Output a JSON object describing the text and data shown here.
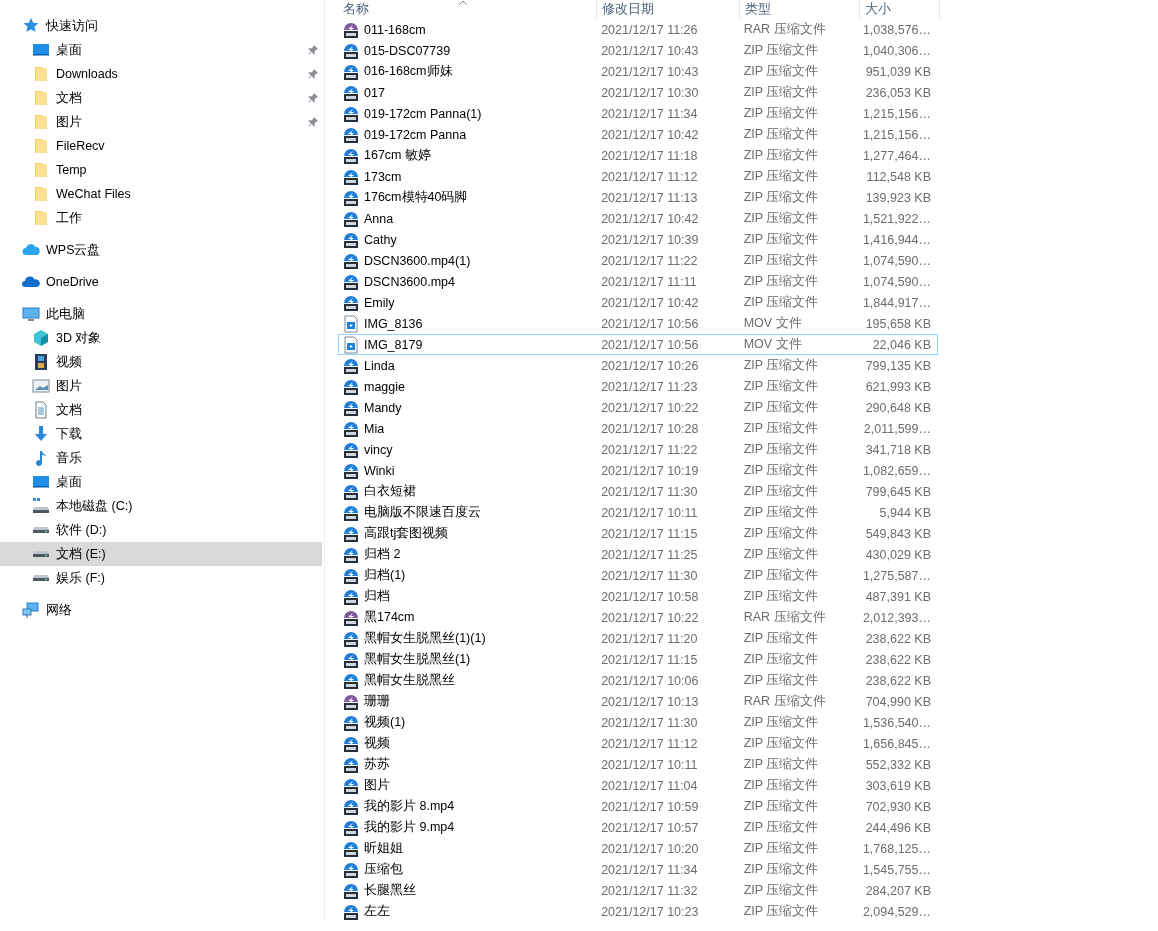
{
  "sidebar": {
    "items": [
      {
        "label": "快速访问",
        "kind": "star",
        "selected": false,
        "children": [
          {
            "label": "桌面",
            "kind": "desktop",
            "pinned": true,
            "selected": false
          },
          {
            "label": "Downloads",
            "kind": "folder",
            "pinned": true,
            "selected": false
          },
          {
            "label": "文档",
            "kind": "folder",
            "pinned": true,
            "selected": false
          },
          {
            "label": "图片",
            "kind": "folder",
            "pinned": true,
            "selected": false
          },
          {
            "label": "FileRecv",
            "kind": "folder",
            "pinned": false,
            "selected": false
          },
          {
            "label": "Temp",
            "kind": "folder",
            "pinned": false,
            "selected": false
          },
          {
            "label": "WeChat Files",
            "kind": "folder",
            "pinned": false,
            "selected": false
          },
          {
            "label": "工作",
            "kind": "folder",
            "pinned": false,
            "selected": false
          }
        ]
      },
      {
        "label": "WPS云盘",
        "kind": "cloud",
        "selected": false
      },
      {
        "label": "OneDrive",
        "kind": "onedrive",
        "selected": false
      },
      {
        "label": "此电脑",
        "kind": "pc",
        "selected": false,
        "children": [
          {
            "label": "3D 对象",
            "kind": "cube",
            "selected": false
          },
          {
            "label": "视频",
            "kind": "film",
            "selected": false
          },
          {
            "label": "图片",
            "kind": "image",
            "selected": false
          },
          {
            "label": "文档",
            "kind": "document",
            "selected": false
          },
          {
            "label": "下载",
            "kind": "download",
            "selected": false
          },
          {
            "label": "音乐",
            "kind": "music",
            "selected": false
          },
          {
            "label": "桌面",
            "kind": "desktop",
            "selected": false
          },
          {
            "label": "本地磁盘 (C:)",
            "kind": "sysdrive",
            "selected": false
          },
          {
            "label": "软件 (D:)",
            "kind": "drive",
            "selected": false
          },
          {
            "label": "文档 (E:)",
            "kind": "drive",
            "selected": true
          },
          {
            "label": "娱乐 (F:)",
            "kind": "drive",
            "selected": false
          }
        ]
      },
      {
        "label": "网络",
        "kind": "network",
        "selected": false
      }
    ]
  },
  "file_list": {
    "columns": [
      {
        "label": "名称",
        "sorted": true
      },
      {
        "label": "修改日期",
        "sorted": false
      },
      {
        "label": "类型",
        "sorted": false
      },
      {
        "label": "大小",
        "sorted": false
      }
    ],
    "rows": [
      {
        "name": "011-168cm",
        "kind": "rar",
        "modified": "2021/12/17 11:26",
        "type": "RAR 压缩文件",
        "size": "1,038,576…",
        "focused": false
      },
      {
        "name": "015-DSC07739",
        "kind": "zip",
        "modified": "2021/12/17 10:43",
        "type": "ZIP 压缩文件",
        "size": "1,040,306…",
        "focused": false
      },
      {
        "name": "016-168cm师妹",
        "kind": "zip",
        "modified": "2021/12/17 10:43",
        "type": "ZIP 压缩文件",
        "size": "951,039 KB",
        "focused": false
      },
      {
        "name": "017",
        "kind": "zip",
        "modified": "2021/12/17 10:30",
        "type": "ZIP 压缩文件",
        "size": "236,053 KB",
        "focused": false
      },
      {
        "name": "019-172cm Panna(1)",
        "kind": "zip",
        "modified": "2021/12/17 11:34",
        "type": "ZIP 压缩文件",
        "size": "1,215,156…",
        "focused": false
      },
      {
        "name": "019-172cm Panna",
        "kind": "zip",
        "modified": "2021/12/17 10:42",
        "type": "ZIP 压缩文件",
        "size": "1,215,156…",
        "focused": false
      },
      {
        "name": "167cm 敏婷",
        "kind": "zip",
        "modified": "2021/12/17 11:18",
        "type": "ZIP 压缩文件",
        "size": "1,277,464…",
        "focused": false
      },
      {
        "name": "173cm",
        "kind": "zip",
        "modified": "2021/12/17 11:12",
        "type": "ZIP 压缩文件",
        "size": "112,548 KB",
        "focused": false
      },
      {
        "name": "176cm模特40码脚",
        "kind": "zip",
        "modified": "2021/12/17 11:13",
        "type": "ZIP 压缩文件",
        "size": "139,923 KB",
        "focused": false
      },
      {
        "name": "Anna",
        "kind": "zip",
        "modified": "2021/12/17 10:42",
        "type": "ZIP 压缩文件",
        "size": "1,521,922…",
        "focused": false
      },
      {
        "name": "Cathy",
        "kind": "zip",
        "modified": "2021/12/17 10:39",
        "type": "ZIP 压缩文件",
        "size": "1,416,944…",
        "focused": false
      },
      {
        "name": "DSCN3600.mp4(1)",
        "kind": "zip",
        "modified": "2021/12/17 11:22",
        "type": "ZIP 压缩文件",
        "size": "1,074,590…",
        "focused": false
      },
      {
        "name": "DSCN3600.mp4",
        "kind": "zip",
        "modified": "2021/12/17 11:11",
        "type": "ZIP 压缩文件",
        "size": "1,074,590…",
        "focused": false
      },
      {
        "name": "Emily",
        "kind": "zip",
        "modified": "2021/12/17 10:42",
        "type": "ZIP 压缩文件",
        "size": "1,844,917…",
        "focused": false
      },
      {
        "name": "IMG_8136",
        "kind": "mov",
        "modified": "2021/12/17 10:56",
        "type": "MOV 文件",
        "size": "195,658 KB",
        "focused": false
      },
      {
        "name": "IMG_8179",
        "kind": "mov",
        "modified": "2021/12/17 10:56",
        "type": "MOV 文件",
        "size": "22,046 KB",
        "focused": true
      },
      {
        "name": "Linda",
        "kind": "zip",
        "modified": "2021/12/17 10:26",
        "type": "ZIP 压缩文件",
        "size": "799,135 KB",
        "focused": false
      },
      {
        "name": "maggie",
        "kind": "zip",
        "modified": "2021/12/17 11:23",
        "type": "ZIP 压缩文件",
        "size": "621,993 KB",
        "focused": false
      },
      {
        "name": "Mandy",
        "kind": "zip",
        "modified": "2021/12/17 10:22",
        "type": "ZIP 压缩文件",
        "size": "290,648 KB",
        "focused": false
      },
      {
        "name": "Mia",
        "kind": "zip",
        "modified": "2021/12/17 10:28",
        "type": "ZIP 压缩文件",
        "size": "2,011,599…",
        "focused": false
      },
      {
        "name": "vincy",
        "kind": "zip",
        "modified": "2021/12/17 11:22",
        "type": "ZIP 压缩文件",
        "size": "341,718 KB",
        "focused": false
      },
      {
        "name": "Winki",
        "kind": "zip",
        "modified": "2021/12/17 10:19",
        "type": "ZIP 压缩文件",
        "size": "1,082,659…",
        "focused": false
      },
      {
        "name": "白衣短裙",
        "kind": "zip",
        "modified": "2021/12/17 11:30",
        "type": "ZIP 压缩文件",
        "size": "799,645 KB",
        "focused": false
      },
      {
        "name": "电脑版不限速百度云",
        "kind": "zip",
        "modified": "2021/12/17 10:11",
        "type": "ZIP 压缩文件",
        "size": "5,944 KB",
        "focused": false
      },
      {
        "name": "高跟tj套图视频",
        "kind": "zip",
        "modified": "2021/12/17 11:15",
        "type": "ZIP 压缩文件",
        "size": "549,843 KB",
        "focused": false
      },
      {
        "name": "归档 2",
        "kind": "zip",
        "modified": "2021/12/17 11:25",
        "type": "ZIP 压缩文件",
        "size": "430,029 KB",
        "focused": false
      },
      {
        "name": "归档(1)",
        "kind": "zip",
        "modified": "2021/12/17 11:30",
        "type": "ZIP 压缩文件",
        "size": "1,275,587…",
        "focused": false
      },
      {
        "name": "归档",
        "kind": "zip",
        "modified": "2021/12/17 10:58",
        "type": "ZIP 压缩文件",
        "size": "487,391 KB",
        "focused": false
      },
      {
        "name": "黑174cm",
        "kind": "rar",
        "modified": "2021/12/17 10:22",
        "type": "RAR 压缩文件",
        "size": "2,012,393…",
        "focused": false
      },
      {
        "name": "黑帽女生脱黑丝(1)(1)",
        "kind": "zip",
        "modified": "2021/12/17 11:20",
        "type": "ZIP 压缩文件",
        "size": "238,622 KB",
        "focused": false
      },
      {
        "name": "黑帽女生脱黑丝(1)",
        "kind": "zip",
        "modified": "2021/12/17 11:15",
        "type": "ZIP 压缩文件",
        "size": "238,622 KB",
        "focused": false
      },
      {
        "name": "黑帽女生脱黑丝",
        "kind": "zip",
        "modified": "2021/12/17 10:06",
        "type": "ZIP 压缩文件",
        "size": "238,622 KB",
        "focused": false
      },
      {
        "name": "珊珊",
        "kind": "rar",
        "modified": "2021/12/17 10:13",
        "type": "RAR 压缩文件",
        "size": "704,990 KB",
        "focused": false
      },
      {
        "name": "视频(1)",
        "kind": "zip",
        "modified": "2021/12/17 11:30",
        "type": "ZIP 压缩文件",
        "size": "1,536,540…",
        "focused": false
      },
      {
        "name": "视频",
        "kind": "zip",
        "modified": "2021/12/17 11:12",
        "type": "ZIP 压缩文件",
        "size": "1,656,845…",
        "focused": false
      },
      {
        "name": "苏苏",
        "kind": "zip",
        "modified": "2021/12/17 10:11",
        "type": "ZIP 压缩文件",
        "size": "552,332 KB",
        "focused": false
      },
      {
        "name": "图片",
        "kind": "zip",
        "modified": "2021/12/17 11:04",
        "type": "ZIP 压缩文件",
        "size": "303,619 KB",
        "focused": false
      },
      {
        "name": "我的影片 8.mp4",
        "kind": "zip",
        "modified": "2021/12/17 10:59",
        "type": "ZIP 压缩文件",
        "size": "702,930 KB",
        "focused": false
      },
      {
        "name": "我的影片 9.mp4",
        "kind": "zip",
        "modified": "2021/12/17 10:57",
        "type": "ZIP 压缩文件",
        "size": "244,496 KB",
        "focused": false
      },
      {
        "name": "昕姐姐",
        "kind": "zip",
        "modified": "2021/12/17 10:20",
        "type": "ZIP 压缩文件",
        "size": "1,768,125…",
        "focused": false
      },
      {
        "name": "压缩包",
        "kind": "zip",
        "modified": "2021/12/17 11:34",
        "type": "ZIP 压缩文件",
        "size": "1,545,755…",
        "focused": false
      },
      {
        "name": "长腿黑丝",
        "kind": "zip",
        "modified": "2021/12/17 11:32",
        "type": "ZIP 压缩文件",
        "size": "284,207 KB",
        "focused": false
      },
      {
        "name": "左左",
        "kind": "zip",
        "modified": "2021/12/17 10:23",
        "type": "ZIP 压缩文件",
        "size": "2,094,529…",
        "focused": false
      }
    ]
  }
}
